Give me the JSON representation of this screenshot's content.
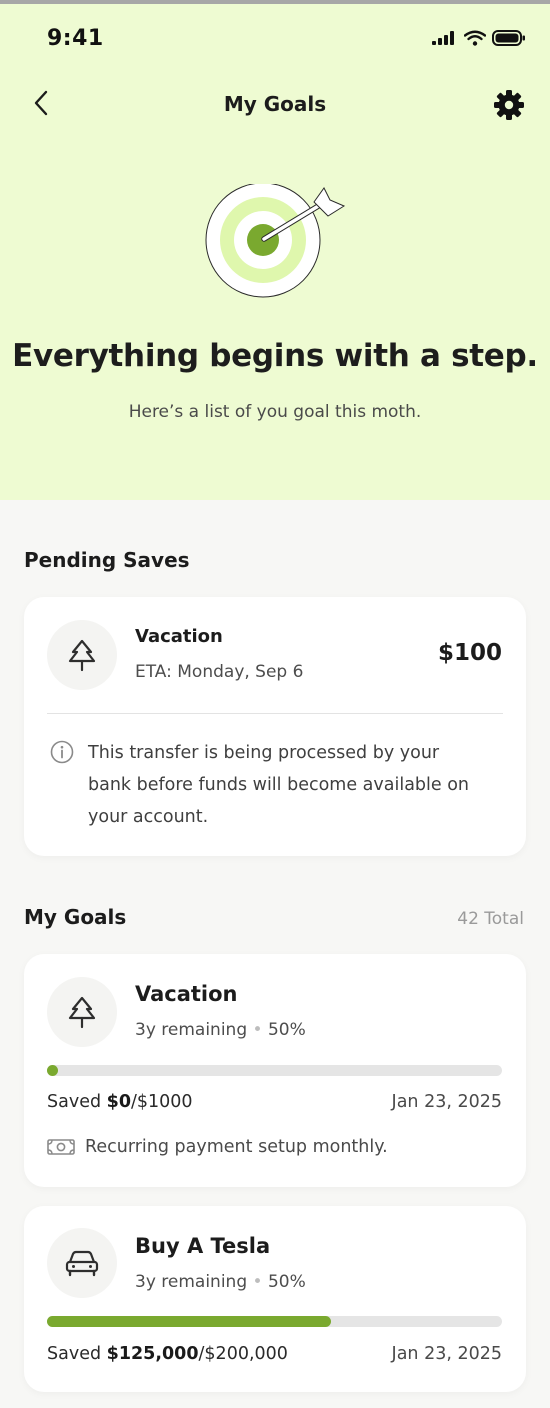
{
  "status_bar": {
    "time": "9:41"
  },
  "nav": {
    "title": "My Goals"
  },
  "hero": {
    "heading": "Everything begins with a step.",
    "subtitle": "Here’s a list of you goal this moth."
  },
  "pending": {
    "section_title": "Pending Saves",
    "item": {
      "icon": "tree-icon",
      "title": "Vacation",
      "eta": "ETA: Monday, Sep 6",
      "amount": "$100",
      "info_line1": "This transfer is being processed by your",
      "info_line2": "bank before funds will become available on",
      "info_line3": "your account."
    }
  },
  "goals": {
    "section_title": "My Goals",
    "total": "42 Total",
    "items": [
      {
        "icon": "tree-icon",
        "title": "Vacation",
        "remaining": "3y remaining",
        "sep": "•",
        "percent": "50%",
        "progress_fraction": 0.0,
        "saved_prefix": "Saved ",
        "saved_amount": "$0",
        "saved_target": "/$1000",
        "date": "Jan 23, 2025",
        "recurring": "Recurring payment setup monthly."
      },
      {
        "icon": "car-icon",
        "title": "Buy A Tesla",
        "remaining": "3y remaining",
        "sep": "•",
        "percent": "50%",
        "progress_fraction": 0.625,
        "saved_prefix": "Saved ",
        "saved_amount": "$125,000",
        "saved_target": "/$200,000",
        "date": "Jan 23, 2025"
      }
    ]
  },
  "colors": {
    "hero_bg": "#eefbd2",
    "accent": "#7aa92f",
    "track": "#e5e5e5"
  }
}
